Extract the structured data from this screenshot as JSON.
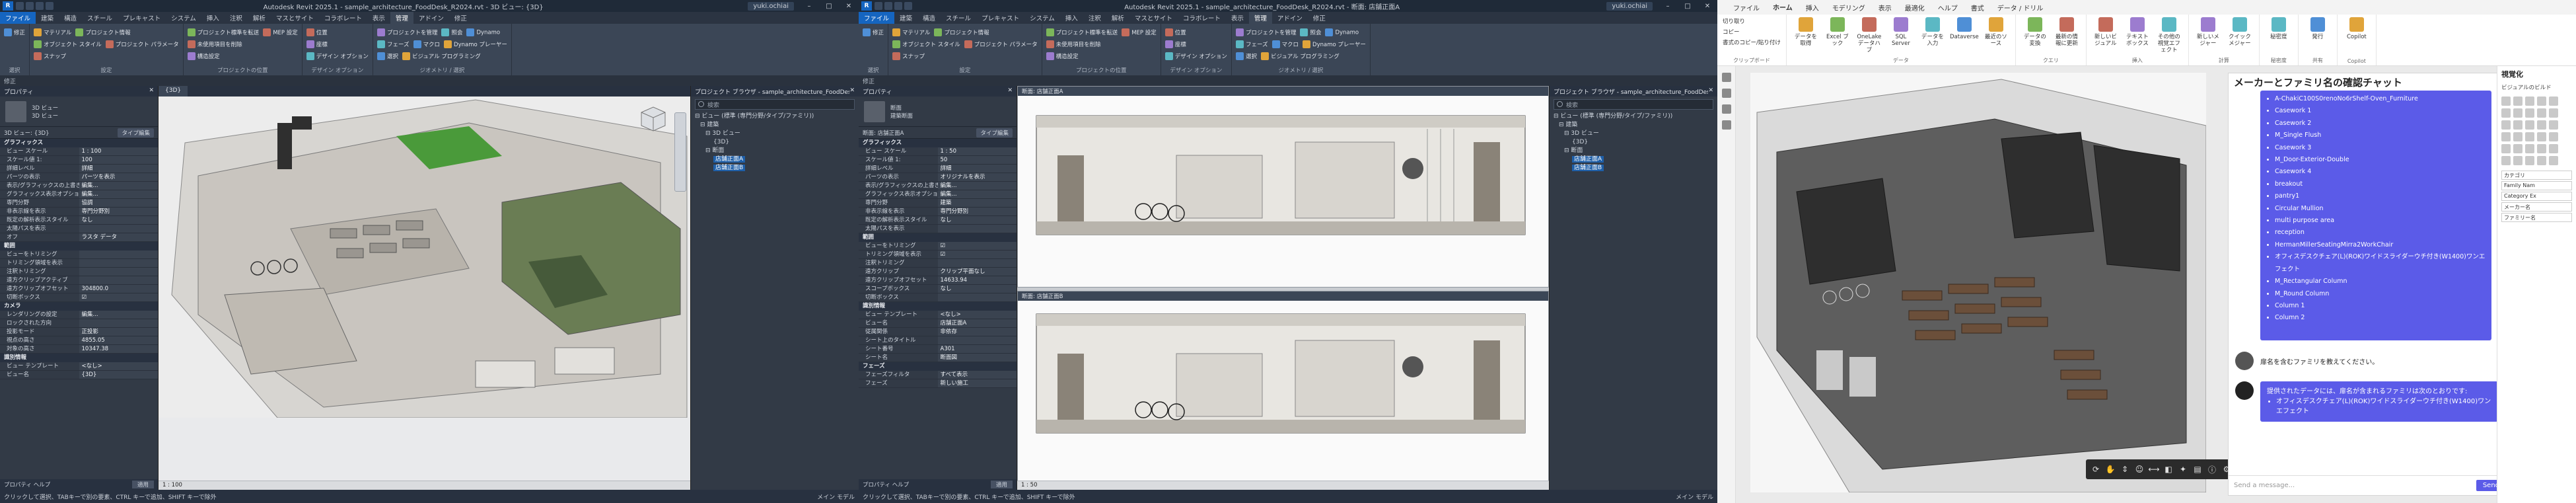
{
  "revit_3d": {
    "title": "Autodesk Revit 2025.1 - sample_architecture_FoodDesk_R2024.rvt - 3D ビュー: {3D}",
    "user": "yuki.ochiai",
    "tabs": [
      "ファイル",
      "建築",
      "構造",
      "スチール",
      "プレキャスト",
      "システム",
      "挿入",
      "注釈",
      "解析",
      "マスとサイト",
      "コラボレート",
      "表示",
      "管理",
      "アドイン",
      "修正"
    ],
    "active_tab": "管理",
    "ribbon_groups": [
      {
        "title": "選択",
        "rows": [
          "修正"
        ]
      },
      {
        "title": "設定",
        "rows": [
          "マテリアル",
          "オブジェクト スタイル",
          "スナップ",
          "プロジェクト情報",
          "プロジェクト パラメータ"
        ]
      },
      {
        "title": "プロジェクトの位置",
        "rows": [
          "プロジェクト標準を転送",
          "未使用項目を削除",
          "構造設定",
          "MEP 設定"
        ]
      },
      {
        "title": "デザイン オプション",
        "rows": [
          "位置",
          "座標",
          "デザイン オプション"
        ]
      },
      {
        "title": "ジオメトリ / 選択",
        "rows": [
          "プロジェクトを管理",
          "フェーズ",
          "選択",
          "照会",
          "マクロ",
          "ビジュアル プログラミング",
          "Dynamo",
          "Dynamo プレーヤー"
        ]
      }
    ],
    "option_bar": "修正",
    "properties": {
      "header": "プロパティ",
      "type_name": "3D ビュー",
      "type_sub": "3D ビュー",
      "instance_line": "3D ビュー: {3D}",
      "edit_type": "タイプ編集",
      "sections": [
        {
          "name": "グラフィックス",
          "rows": [
            [
              "ビュー スケール",
              "1 : 100"
            ],
            [
              "スケール値 1:",
              "100"
            ],
            [
              "詳細レベル",
              "詳細"
            ],
            [
              "パーツの表示",
              "パーツを表示"
            ],
            [
              "表示/グラフィックスの上書き",
              "編集..."
            ],
            [
              "グラフィックス表示オプション",
              "編集..."
            ],
            [
              "専門分野",
              "協調"
            ],
            [
              "非表示線を表示",
              "専門分野別"
            ],
            [
              "既定の解析表示スタイル",
              "なし"
            ],
            [
              "太陽パスを表示",
              ""
            ],
            [
              "オフ",
              "ラスタ データ"
            ]
          ]
        },
        {
          "name": "範囲",
          "rows": [
            [
              "ビューをトリミング",
              ""
            ],
            [
              "トリミング領域を表示",
              ""
            ],
            [
              "注釈トリミング",
              ""
            ],
            [
              "遠方クリップアクティブ",
              ""
            ],
            [
              "遠方クリップオフセット",
              "304800.0"
            ],
            [
              "切断ボックス",
              "☑"
            ]
          ]
        },
        {
          "name": "カメラ",
          "rows": [
            [
              "レンダリングの設定",
              "編集..."
            ],
            [
              "ロックされた方向",
              ""
            ],
            [
              "投影モード",
              "正投影"
            ],
            [
              "視点の高さ",
              "4855.05"
            ],
            [
              "対象の高さ",
              "10347.38"
            ]
          ]
        },
        {
          "name": "識別情報",
          "rows": [
            [
              "ビュー テンプレート",
              "<なし>"
            ],
            [
              "ビュー名",
              "{3D}"
            ]
          ]
        }
      ],
      "help_link": "プロパティ ヘルプ",
      "apply": "適用"
    },
    "browser": {
      "header": "プロジェクト ブラウザ - sample_architecture_FoodDesk_R2024.rvt",
      "search_placeholder": "検索",
      "items": [
        "ビュー (標準 (専門分野/タイプ/ファミリ))",
        "建築",
        "3D ビュー",
        "{3D}",
        "断面",
        "店舗正面A",
        "店舗正面B"
      ]
    },
    "view_tab": "{3D}",
    "view_scale": "1 : 100",
    "status": [
      "クリックして選択、TABキーで別の要素、CTRL キーで追加、SHIFT キーで除外",
      "メイン モデル"
    ]
  },
  "revit_sheet": {
    "title": "Autodesk Revit 2025.1 - sample_architecture_FoodDesk_R2024.rvt - 断面: 店舗正面A",
    "user": "yuki.ochiai",
    "properties": {
      "header": "プロパティ",
      "type_name": "断面",
      "type_sub": "建築断面",
      "instance_line": "断面: 店舗正面A",
      "edit_type": "タイプ編集",
      "sections": [
        {
          "name": "グラフィックス",
          "rows": [
            [
              "ビュー スケール",
              "1 : 50"
            ],
            [
              "スケール値 1:",
              "50"
            ],
            [
              "詳細レベル",
              "詳細"
            ],
            [
              "パーツの表示",
              "オリジナルを表示"
            ],
            [
              "表示/グラフィックスの上書き",
              "編集..."
            ],
            [
              "グラフィックス表示オプション",
              "編集..."
            ],
            [
              "専門分野",
              "建築"
            ],
            [
              "非表示線を表示",
              "専門分野別"
            ],
            [
              "既定の解析表示スタイル",
              "なし"
            ],
            [
              "太陽パスを表示",
              ""
            ]
          ]
        },
        {
          "name": "範囲",
          "rows": [
            [
              "ビューをトリミング",
              "☑"
            ],
            [
              "トリミング領域を表示",
              "☑"
            ],
            [
              "注釈トリミング",
              ""
            ],
            [
              "遠方クリップ",
              "クリップ平面なし"
            ],
            [
              "遠方クリップオフセット",
              "14633.94"
            ],
            [
              "スコープボックス",
              "なし"
            ],
            [
              "切断ボックス",
              ""
            ]
          ]
        },
        {
          "name": "識別情報",
          "rows": [
            [
              "ビュー テンプレート",
              "<なし>"
            ],
            [
              "ビュー名",
              "店舗正面A"
            ],
            [
              "従属関係",
              "非依存"
            ],
            [
              "シート上のタイトル",
              ""
            ],
            [
              "シート番号",
              "A301"
            ],
            [
              "シート名",
              "断面図"
            ]
          ]
        },
        {
          "name": "フェーズ",
          "rows": [
            [
              "フェーズフィルタ",
              "すべて表示"
            ],
            [
              "フェーズ",
              "新しい施工"
            ]
          ]
        }
      ],
      "help_link": "プロパティ ヘルプ",
      "apply": "適用"
    },
    "browser": {
      "header": "プロジェクト ブラウザ - sample_architecture_FoodDesk_R2024.rvt",
      "search_placeholder": "検索",
      "items": [
        "ビュー (標準 (専門分野/タイプ/ファミリ))",
        "建築",
        "3D ビュー",
        "{3D}",
        "断面",
        "店舗正面A",
        "店舗正面B"
      ]
    },
    "panes": [
      "断面: 店舗正面A",
      "断面: 店舗正面B"
    ],
    "view_scale": "1 : 50",
    "status": [
      "クリックして選択、TABキーで別の要素、CTRL キーで追加、SHIFT キーで除外",
      "メイン モデル"
    ]
  },
  "powerbi": {
    "tabs": [
      "ファイル",
      "ホーム",
      "挿入",
      "モデリング",
      "表示",
      "最適化",
      "ヘルプ",
      "書式",
      "データ / ドリル"
    ],
    "active_tab": "ホーム",
    "ribbon": [
      {
        "title": "クリップボード",
        "small": [
          "切り取り",
          "コピー",
          "書式のコピー/貼り付け"
        ]
      },
      {
        "title": "データ",
        "buttons": [
          "データを取得",
          "Excel ブック",
          "OneLake データハブ",
          "SQL Server",
          "データを入力",
          "Dataverse",
          "最近のソース"
        ]
      },
      {
        "title": "クエリ",
        "buttons": [
          "データの変換",
          "最新の情報に更新"
        ]
      },
      {
        "title": "挿入",
        "buttons": [
          "新しいビジュアル",
          "テキスト ボックス",
          "その他の視覚エフェクト"
        ]
      },
      {
        "title": "計算",
        "buttons": [
          "新しいメジャー",
          "クイック メジャー"
        ]
      },
      {
        "title": "秘密度",
        "buttons": [
          "秘密度"
        ]
      },
      {
        "title": "共有",
        "buttons": [
          "発行"
        ]
      },
      {
        "title": "Copilot",
        "buttons": [
          "Copilot"
        ]
      }
    ],
    "chat": {
      "title": "メーカーとファミリ名の確認チャット",
      "list": [
        "A-ChakiC100S0renoNo6rShelf-Oven_Furniture",
        "Casework 1",
        "Casework 2",
        "M_Single Flush",
        "Casework 3",
        "M_Door-Exterior-Double",
        "Casework 4",
        "breakout",
        "pantry1",
        "Circular Mullion",
        "multi purpose area",
        "reception",
        "HermanMillerSeatingMirra2WorkChair",
        "オフィスデスクチェア(L)(ROK)ワイドスライダーウチ付き(W1400)ワンエフェクト",
        "M_Rectangular Column",
        "M_Round Column",
        "Column 1",
        "Column 2"
      ],
      "user_msg": "扉名を含むファミリを教えてください。",
      "bot_intro": "提供されたデータには、扉名が含まれるファミリは次のとおりです:",
      "bot_list": [
        "オフィスデスクチェア(L)(ROK)ワイドスライダーウチ付き(W1400)ワンエフェクト"
      ],
      "input_placeholder": "Send a message...",
      "send": "Send"
    },
    "right_panel": {
      "title": "視覚化",
      "subtitle": "ビジュアルのビルド",
      "fields": [
        "カテゴリ",
        "Family Nam",
        "Category Ex",
        "メーカー名",
        "ファミリー名"
      ]
    }
  }
}
